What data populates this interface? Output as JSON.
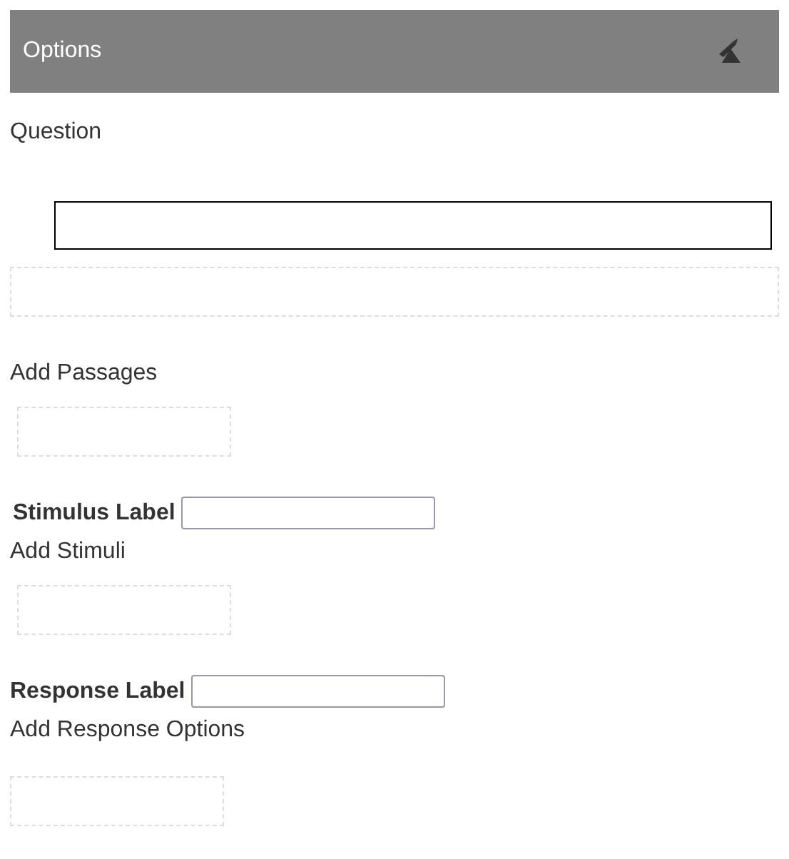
{
  "header": {
    "title": "Options"
  },
  "question": {
    "label": "Question"
  },
  "passages": {
    "label": "Add Passages"
  },
  "stimuli": {
    "field_label": "Stimulus Label",
    "label": "Add Stimuli"
  },
  "responses": {
    "field_label": "Response Label",
    "label": "Add Response Options"
  }
}
